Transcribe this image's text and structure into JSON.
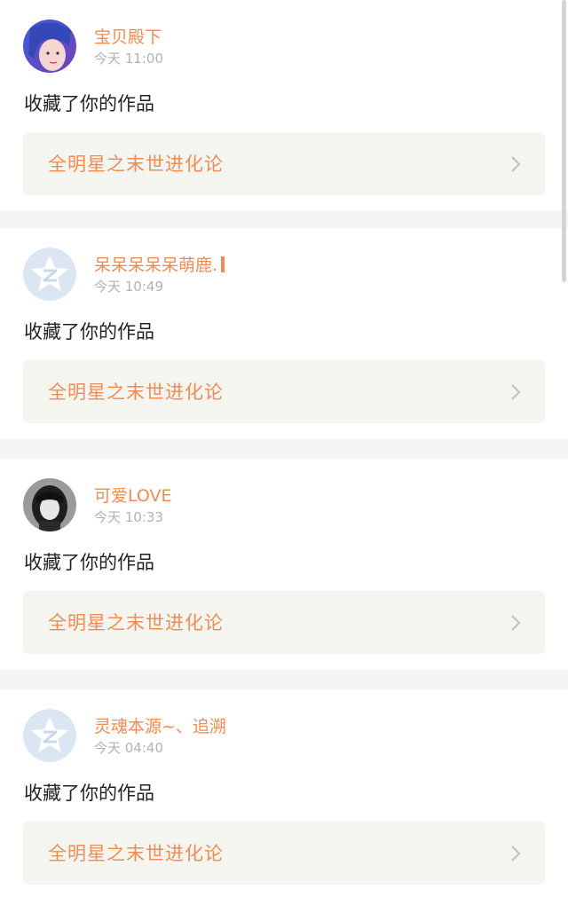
{
  "notifications": [
    {
      "username": "宝贝殿下",
      "time": "今天 11:00",
      "action": "收藏了你的作品",
      "work_title": "全明星之末世进化论"
    },
    {
      "username": "呆呆呆呆呆萌鹿.",
      "time": "今天 10:49",
      "action": "收藏了你的作品",
      "work_title": "全明星之末世进化论"
    },
    {
      "username": "可爱LOVE",
      "time": "今天 10:33",
      "action": "收藏了你的作品",
      "work_title": "全明星之末世进化论"
    },
    {
      "username": "灵魂本源~、追溯",
      "time": "今天 04:40",
      "action": "收藏了你的作品",
      "work_title": "全明星之末世进化论"
    }
  ],
  "colors": {
    "accent": "#ef8b55",
    "muted": "#b2b2b2",
    "link_bg": "#f5f5ef",
    "default_avatar": "#dbe6f2"
  }
}
